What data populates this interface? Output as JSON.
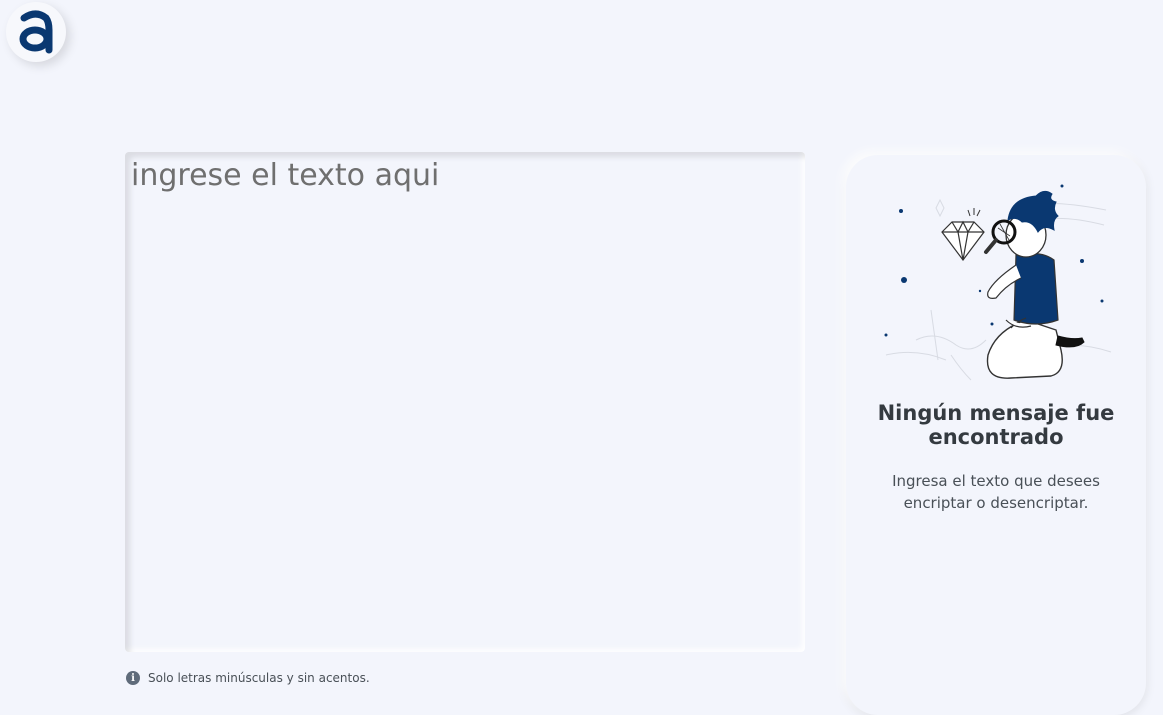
{
  "logo": {
    "letter": "a",
    "icon": "alura-logo-icon"
  },
  "input": {
    "placeholder": "ingrese el texto aqui",
    "value": ""
  },
  "hint": {
    "icon": "info-icon",
    "symbol": "i",
    "text": "Solo letras minúsculas y sin acentos."
  },
  "result_card": {
    "illustration": "person-with-magnifying-glass-and-diamond-illustration",
    "title": "Ningún mensaje fue encontrado",
    "text": "Ingresa el texto que desees encriptar o desencriptar."
  },
  "colors": {
    "background": "#f3f5fc",
    "brand_dark_blue": "#0a3871",
    "title_text": "#343a40",
    "body_text": "#495057"
  }
}
